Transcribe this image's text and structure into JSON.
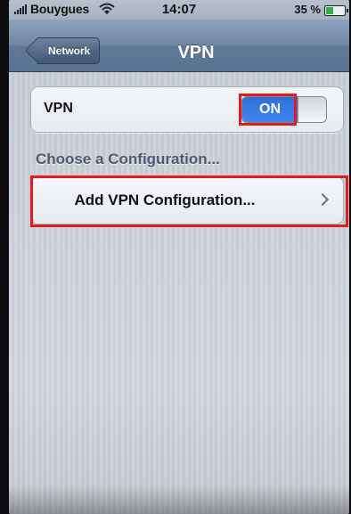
{
  "status_bar": {
    "carrier": "Bouygues",
    "time": "14:07",
    "battery_percent": "35 %",
    "battery_level": 0.35,
    "signal_icon": "signal-bars-icon",
    "wifi_icon": "wifi-icon",
    "battery_icon": "battery-icon"
  },
  "nav": {
    "back_label": "Network",
    "title": "VPN"
  },
  "vpn_row": {
    "label": "VPN",
    "toggle_label": "ON",
    "toggle_on": true
  },
  "section_header": "Choose a Configuration...",
  "add_config": {
    "label": "Add VPN Configuration...",
    "accessory_icon": "chevron-right-icon"
  },
  "colors": {
    "toggle_on": "#3f86f0",
    "nav_bar": "#6f87a5",
    "highlight": "#e21c1c"
  }
}
